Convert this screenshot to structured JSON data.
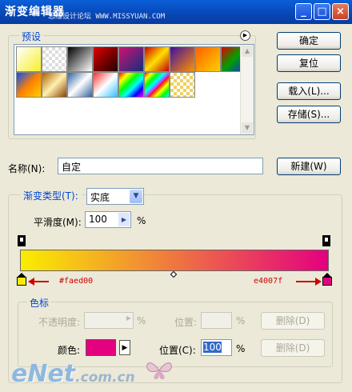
{
  "window": {
    "title": "渐变编辑器",
    "watermark": "思缘设计论坛 WWW.MISSYUAN.COM"
  },
  "titlebar_buttons": {
    "minimize": "_",
    "maximize": "□",
    "close": "×"
  },
  "presets": {
    "label": "预设",
    "menu_icon": "▶"
  },
  "buttons": {
    "ok": "确定",
    "reset": "复位",
    "load": "载入(L)...",
    "save": "存储(S)...",
    "new": "新建(W)"
  },
  "name_field": {
    "label": "名称(N):",
    "value": "自定"
  },
  "gradient_type": {
    "label": "渐变类型(T):",
    "value": "实底"
  },
  "smoothness": {
    "label": "平滑度(M):",
    "value": "100",
    "unit": "%"
  },
  "gradient": {
    "start_color": "#faed00",
    "end_color": "#e4007f",
    "start_label": "#faed00",
    "end_label": "e4007f"
  },
  "color_stops": {
    "label": "色标",
    "opacity_label": "不透明度:",
    "opacity_unit": "%",
    "location_label_top": "位置:",
    "location_unit_top": "%",
    "delete_top": "删除(D)",
    "color_label": "颜色:",
    "color_value": "#e4007f",
    "location_label": "位置(C):",
    "location_value": "100",
    "location_unit": "%",
    "delete": "删除(D)"
  },
  "logo": {
    "text_main": "eNet",
    "text_tld": ".com.cn"
  },
  "preset_swatches": [
    "linear-gradient(135deg,#ffffff,#f6f02a)",
    "repeating-conic-gradient(#ddd 0 25%,#fff 0 50%) 0 0/8px 8px",
    "linear-gradient(135deg,#000,#fff)",
    "linear-gradient(135deg,#e00000,#200000)",
    "linear-gradient(135deg,#d01070,#103080)",
    "linear-gradient(135deg,#d00000,#ffe000,#c00000)",
    "linear-gradient(135deg,#4010a0,#ff9000)",
    "linear-gradient(135deg,#ff6000,#ffd000)",
    "linear-gradient(135deg,#e00000,#00a000,#1030d0)",
    "linear-gradient(135deg,#0050ff,#ff8000,#ffd000)",
    "linear-gradient(135deg,#b06000,#fff0b0,#8a4000)",
    "linear-gradient(135deg,#3060a0,#ffffff,#3060a0)",
    "linear-gradient(135deg,#ff3030,#ffffff,#30c0ff)",
    "linear-gradient(135deg,#ff0000,#ffff00,#00ff00,#00ffff,#0000ff,#ff00ff)",
    "repeating-linear-gradient(135deg,#ff0000 0,#ffff00 6px,#00ff00 12px,#00ffff 18px,#ff00ff 24px)",
    "repeating-conic-gradient(#f0d060 0 25%,#fff 0 50%) 0 0/8px 8px"
  ]
}
